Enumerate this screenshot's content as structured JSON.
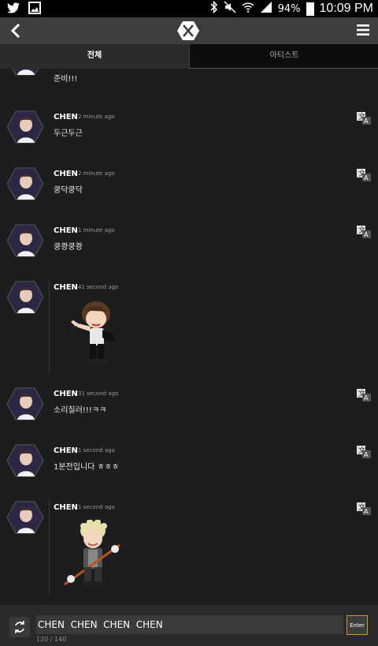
{
  "status_bar": {
    "battery": "94%",
    "time": "10:09 PM",
    "icons": [
      "twitter-icon",
      "gallery-icon",
      "bluetooth-icon",
      "mute-icon",
      "wifi-icon",
      "signal-icon",
      "battery-icon"
    ]
  },
  "app_bar": {
    "back_icon": "back-arrow-icon",
    "logo_icon": "exo-logo-icon",
    "menu_icon": "hamburger-menu-icon"
  },
  "tabs": [
    {
      "label": "전체",
      "active": true
    },
    {
      "label": "아티스트",
      "active": false
    }
  ],
  "messages": [
    {
      "author": "",
      "time": "",
      "text": "준비!!!",
      "sticker": null
    },
    {
      "author": "CHEN",
      "time": "2 minute ago",
      "text": "두근두근",
      "sticker": null
    },
    {
      "author": "CHEN",
      "time": "2 minute ago",
      "text": "쿵닥쿵닥",
      "sticker": null
    },
    {
      "author": "CHEN",
      "time": "1 minute ago",
      "text": "쿵쾅쿵쾅",
      "sticker": null
    },
    {
      "author": "CHEN",
      "time": "41 second ago",
      "text": "",
      "sticker": "cartoon-sticker-pointing"
    },
    {
      "author": "CHEN",
      "time": "31 second ago",
      "text": "소리질러!!!ㅋㅋ",
      "sticker": null
    },
    {
      "author": "CHEN",
      "time": "1 second ago",
      "text": "1분전입니다 ㅎㅎㅎ",
      "sticker": null
    },
    {
      "author": "CHEN",
      "time": "1 second ago",
      "text": "",
      "sticker": "cartoon-sticker-staff"
    }
  ],
  "input": {
    "value": "CHEN  CHEN  CHEN  CHEN",
    "enter_label": "Enter",
    "counter": "120 / 140"
  },
  "colors": {
    "background": "#1d1d1d",
    "app_bar": "#3e3e3e",
    "enter_border": "#c4953a"
  }
}
